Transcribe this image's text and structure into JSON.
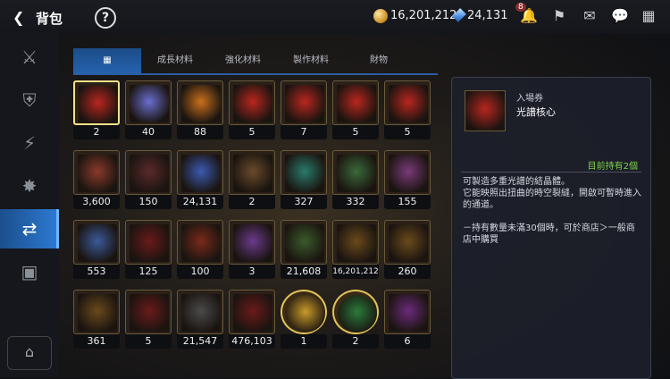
{
  "header": {
    "back_icon": "back-arrow-icon",
    "title": "背包",
    "help_label": "?",
    "gold_amount": "16,201,212",
    "gem_amount": "24,131",
    "notif_badge": "8"
  },
  "sidebar": {
    "items": [
      {
        "icon": "equipment-icon"
      },
      {
        "icon": "shield-icon"
      },
      {
        "icon": "lightning-icon"
      },
      {
        "icon": "burst-icon"
      },
      {
        "icon": "swap-icon",
        "active": true
      },
      {
        "icon": "chest-icon"
      }
    ],
    "bottom_icon": "storage-icon"
  },
  "tabs": [
    {
      "label": "",
      "icon": "grid-icon",
      "active": true
    },
    {
      "label": "成長材料"
    },
    {
      "label": "強化材料"
    },
    {
      "label": "製作材料"
    },
    {
      "label": "財物"
    }
  ],
  "items": [
    {
      "count": "2",
      "color": "#b8261e",
      "selected": true
    },
    {
      "count": "40",
      "color": "#6a6fd0"
    },
    {
      "count": "88",
      "color": "#c9701c"
    },
    {
      "count": "5",
      "color": "#b8261e"
    },
    {
      "count": "7",
      "color": "#b8261e"
    },
    {
      "count": "5",
      "color": "#b8261e"
    },
    {
      "count": "5",
      "color": "#b8261e"
    },
    {
      "count": "3,600",
      "color": "#8a3a2a"
    },
    {
      "count": "150",
      "color": "#5a2a2a"
    },
    {
      "count": "24,131",
      "color": "#3a5ab0"
    },
    {
      "count": "2",
      "color": "#6a4a2a"
    },
    {
      "count": "327",
      "color": "#2a7a6a"
    },
    {
      "count": "332",
      "color": "#3a6a3a"
    },
    {
      "count": "155",
      "color": "#7a3a7a"
    },
    {
      "count": "553",
      "color": "#3a5a9a"
    },
    {
      "count": "125",
      "color": "#6a1a1a"
    },
    {
      "count": "100",
      "color": "#7a2a1a"
    },
    {
      "count": "3",
      "color": "#6a3a8a"
    },
    {
      "count": "21,608",
      "color": "#3a5a2a"
    },
    {
      "count": "16,201,212",
      "color": "#6a4a1a"
    },
    {
      "count": "260",
      "color": "#6a4a1a"
    },
    {
      "count": "361",
      "color": "#6a4a1a"
    },
    {
      "count": "5",
      "color": "#6a1a1a"
    },
    {
      "count": "21,547",
      "color": "#4a4a4a"
    },
    {
      "count": "476,103",
      "color": "#6a1a1a"
    },
    {
      "count": "1",
      "color": "#c99a2a",
      "round": true
    },
    {
      "count": "2",
      "color": "#2a7a3a",
      "round": true
    },
    {
      "count": "6",
      "color": "#6a2a7a"
    }
  ],
  "detail": {
    "category": "入場券",
    "name": "光譜核心",
    "hold": "目前持有2個",
    "description": "可製造多重光譜的結晶體。\n它能映照出扭曲的時空裂縫，開啟可暫時進入的通道。\n\n－持有數量未滿30個時，可於商店＞一般商店中購買",
    "item_color": "#b8261e"
  }
}
